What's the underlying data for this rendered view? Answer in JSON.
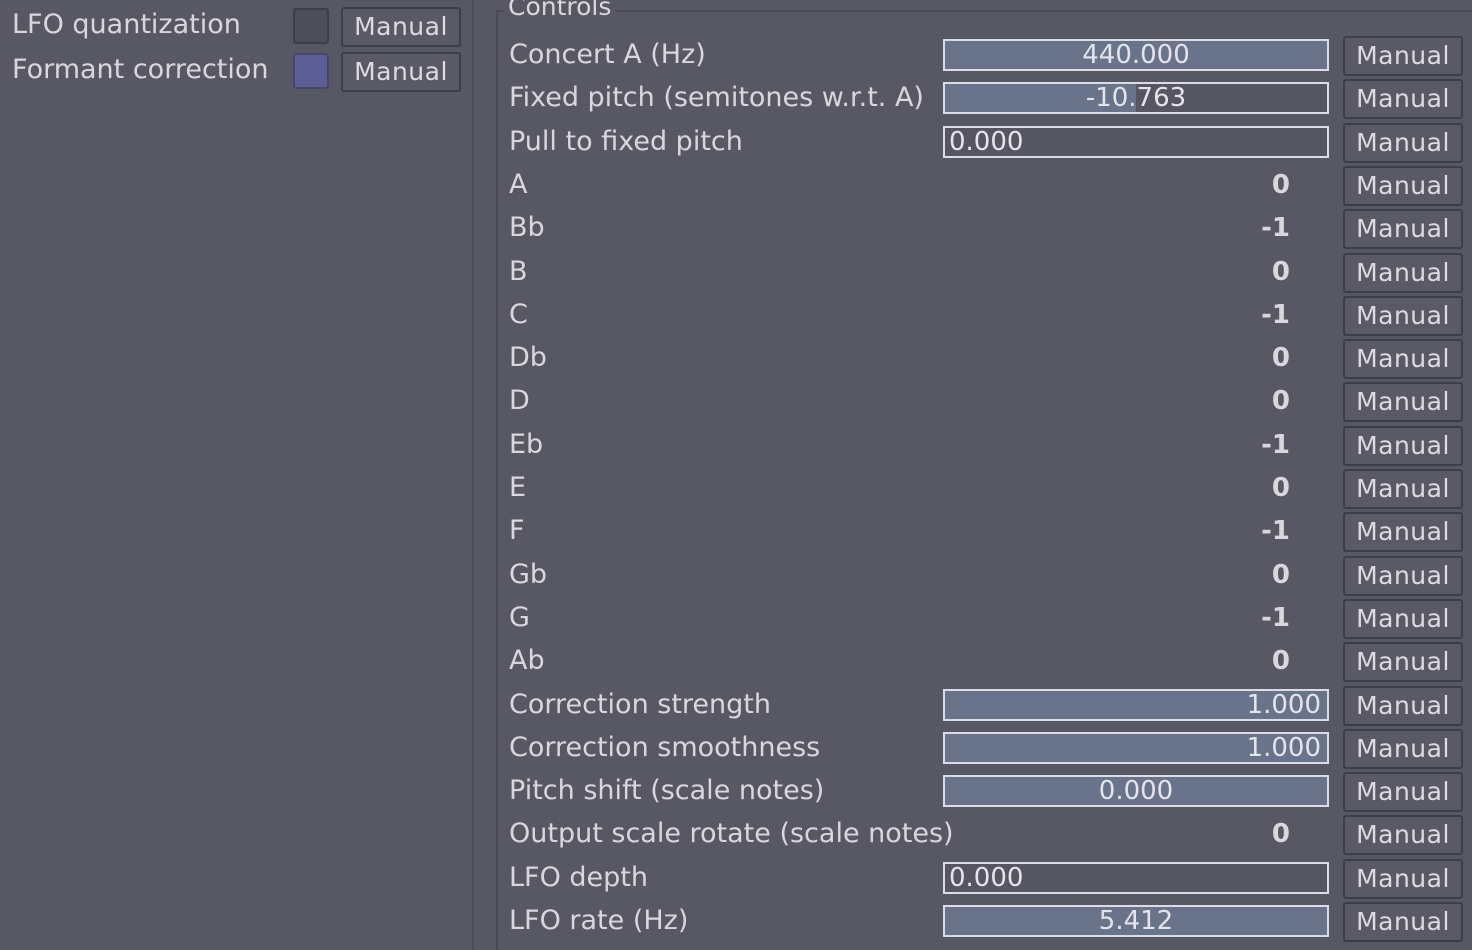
{
  "left": {
    "rows": [
      {
        "label": "LFO quantization",
        "checked": false,
        "button": "Manual"
      },
      {
        "label": "Formant correction",
        "checked": true,
        "button": "Manual"
      }
    ]
  },
  "controls": {
    "title": "Controls",
    "rows": [
      {
        "label": "Concert A (Hz)",
        "kind": "slider",
        "value": "440.000",
        "fill": 1.0,
        "align": "center",
        "button": "Manual"
      },
      {
        "label": "Fixed pitch (semitones w.r.t. A)",
        "kind": "slider",
        "value": "-10.763",
        "fill": 0.5,
        "align": "center",
        "button": "Manual"
      },
      {
        "label": "Pull to fixed pitch",
        "kind": "slider",
        "value": "0.000",
        "fill": 0.0,
        "align": "left",
        "button": "Manual"
      },
      {
        "label": "A",
        "kind": "int",
        "value": "0",
        "button": "Manual"
      },
      {
        "label": "Bb",
        "kind": "int",
        "value": "-1",
        "button": "Manual"
      },
      {
        "label": "B",
        "kind": "int",
        "value": "0",
        "button": "Manual"
      },
      {
        "label": "C",
        "kind": "int",
        "value": "-1",
        "button": "Manual"
      },
      {
        "label": "Db",
        "kind": "int",
        "value": "0",
        "button": "Manual"
      },
      {
        "label": "D",
        "kind": "int",
        "value": "0",
        "button": "Manual"
      },
      {
        "label": "Eb",
        "kind": "int",
        "value": "-1",
        "button": "Manual"
      },
      {
        "label": "E",
        "kind": "int",
        "value": "0",
        "button": "Manual"
      },
      {
        "label": "F",
        "kind": "int",
        "value": "-1",
        "button": "Manual"
      },
      {
        "label": "Gb",
        "kind": "int",
        "value": "0",
        "button": "Manual"
      },
      {
        "label": "G",
        "kind": "int",
        "value": "-1",
        "button": "Manual"
      },
      {
        "label": "Ab",
        "kind": "int",
        "value": "0",
        "button": "Manual"
      },
      {
        "label": "Correction strength",
        "kind": "slider",
        "value": "1.000",
        "fill": 1.0,
        "align": "right",
        "button": "Manual"
      },
      {
        "label": "Correction smoothness",
        "kind": "slider",
        "value": "1.000",
        "fill": 1.0,
        "align": "right",
        "button": "Manual"
      },
      {
        "label": "Pitch shift (scale notes)",
        "kind": "slider",
        "value": "0.000",
        "fill": 1.0,
        "align": "center",
        "button": "Manual"
      },
      {
        "label": "Output scale rotate (scale notes)",
        "kind": "int",
        "value": "0",
        "button": "Manual"
      },
      {
        "label": "LFO depth",
        "kind": "slider",
        "value": "0.000",
        "fill": 0.0,
        "align": "left",
        "button": "Manual"
      },
      {
        "label": "LFO rate (Hz)",
        "kind": "slider",
        "value": "5.412",
        "fill": 1.0,
        "align": "center",
        "button": "Manual"
      }
    ]
  },
  "colors": {
    "background": "#585865",
    "slider_fill": "#69738a",
    "checkbox_on": "#5e5e96"
  }
}
